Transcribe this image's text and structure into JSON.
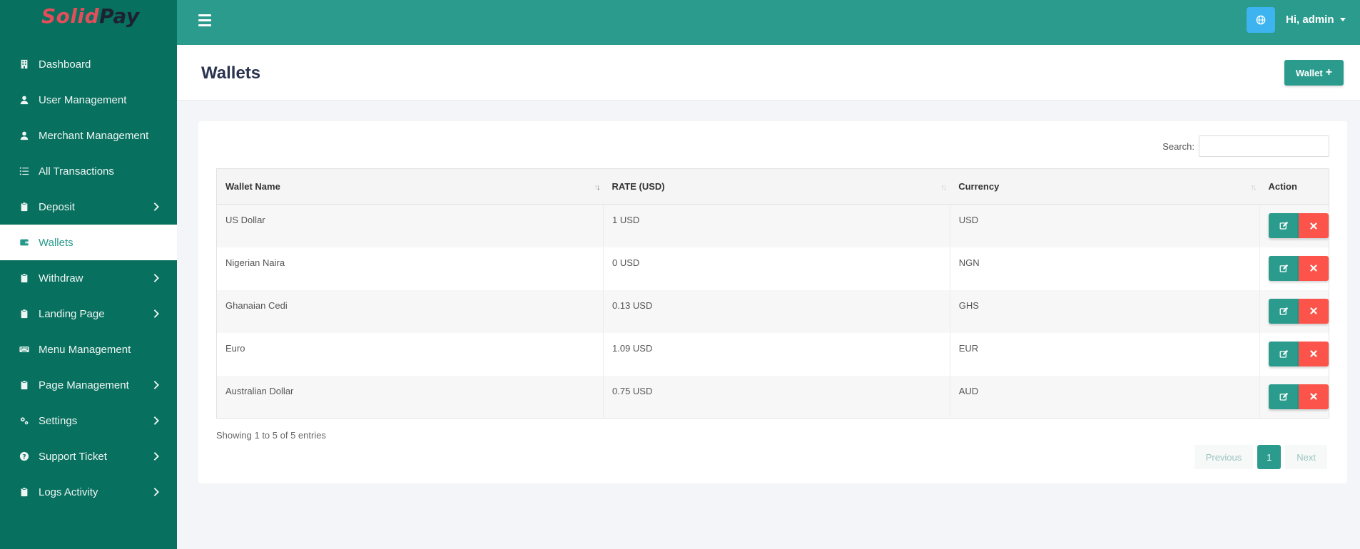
{
  "brand": {
    "part1": "Solid",
    "part2": "Pay"
  },
  "sidebar": {
    "items": [
      {
        "label": "Dashboard",
        "icon": "building-icon",
        "has_children": false,
        "active": false
      },
      {
        "label": "User Management",
        "icon": "user-icon",
        "has_children": false,
        "active": false
      },
      {
        "label": "Merchant Management",
        "icon": "user-icon",
        "has_children": false,
        "active": false
      },
      {
        "label": "All Transactions",
        "icon": "list-icon",
        "has_children": false,
        "active": false
      },
      {
        "label": "Deposit",
        "icon": "clipboard-icon",
        "has_children": true,
        "active": false
      },
      {
        "label": "Wallets",
        "icon": "wallet-icon",
        "has_children": false,
        "active": true
      },
      {
        "label": "Withdraw",
        "icon": "clipboard-icon",
        "has_children": true,
        "active": false
      },
      {
        "label": "Landing Page",
        "icon": "clipboard-icon",
        "has_children": true,
        "active": false
      },
      {
        "label": "Menu Management",
        "icon": "keyboard-icon",
        "has_children": false,
        "active": false
      },
      {
        "label": "Page Management",
        "icon": "clipboard-icon",
        "has_children": true,
        "active": false
      },
      {
        "label": "Settings",
        "icon": "cogs-icon",
        "has_children": true,
        "active": false
      },
      {
        "label": "Support Ticket",
        "icon": "question-icon",
        "has_children": true,
        "active": false
      },
      {
        "label": "Logs Activity",
        "icon": "clipboard-icon",
        "has_children": true,
        "active": false
      }
    ]
  },
  "topbar": {
    "user_greeting": "Hi, admin"
  },
  "page": {
    "title": "Wallets",
    "add_button_label": "Wallet"
  },
  "search": {
    "label": "Search:",
    "value": ""
  },
  "table": {
    "headers": [
      "Wallet Name",
      "RATE (USD)",
      "Currency",
      "Action"
    ],
    "rows": [
      {
        "name": "US Dollar",
        "rate": "1 USD",
        "currency": "USD"
      },
      {
        "name": "Nigerian Naira",
        "rate": "0 USD",
        "currency": "NGN"
      },
      {
        "name": "Ghanaian Cedi",
        "rate": "0.13 USD",
        "currency": "GHS"
      },
      {
        "name": "Euro",
        "rate": "1.09 USD",
        "currency": "EUR"
      },
      {
        "name": "Australian Dollar",
        "rate": "0.75 USD",
        "currency": "AUD"
      }
    ]
  },
  "footer": {
    "info": "Showing 1 to 5 of 5 entries",
    "previous": "Previous",
    "current_page": "1",
    "next": "Next"
  },
  "colors": {
    "sidebar_bg": "#08705f",
    "topbar_bg": "#2a9b8c",
    "accent": "#2a9b8c",
    "danger": "#fc544b",
    "globe_btn": "#3db4ef"
  }
}
